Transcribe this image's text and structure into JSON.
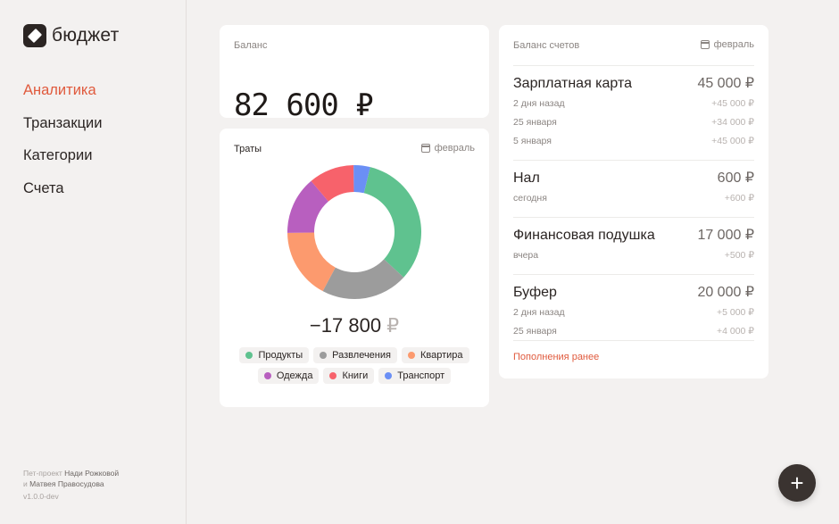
{
  "app": {
    "logo_text": "бюджет"
  },
  "nav": {
    "items": [
      {
        "label": "Аналитика",
        "active": true
      },
      {
        "label": "Транзакции",
        "active": false
      },
      {
        "label": "Категории",
        "active": false
      },
      {
        "label": "Счета",
        "active": false
      }
    ]
  },
  "credits": {
    "prefix": "Пет-проект ",
    "author1": "Нади Рожковой",
    "and": "и ",
    "author2": "Матвея Правосудова",
    "version": "v1.0.0-dev"
  },
  "balance": {
    "label": "Баланс",
    "value": "82 600 ₽"
  },
  "spending": {
    "title": "Траты",
    "month": "февраль",
    "total_value": "−17 800",
    "total_currency": "₽",
    "categories": [
      {
        "name": "Продукты",
        "color": "#5fc28f",
        "share": 33
      },
      {
        "name": "Развлечения",
        "color": "#9c9c9c",
        "share": 21
      },
      {
        "name": "Квартира",
        "color": "#fc9a6e",
        "share": 17
      },
      {
        "name": "Одежда",
        "color": "#b85fbf",
        "share": 14
      },
      {
        "name": "Книги",
        "color": "#f7626b",
        "share": 11
      },
      {
        "name": "Транспорт",
        "color": "#6b8ff5",
        "share": 4
      }
    ]
  },
  "accounts": {
    "title": "Баланс счетов",
    "month": "февраль",
    "items": [
      {
        "name": "Зарплатная карта",
        "amount": "45 000 ₽",
        "rows": [
          {
            "date": "2 дня назад",
            "value": "+45 000 ₽"
          },
          {
            "date": "25 января",
            "value": "+34 000 ₽"
          },
          {
            "date": "5 января",
            "value": "+45 000 ₽"
          }
        ]
      },
      {
        "name": "Нал",
        "amount": "600 ₽",
        "rows": [
          {
            "date": "сегодня",
            "value": "+600 ₽"
          }
        ]
      },
      {
        "name": "Финансовая подушка",
        "amount": "17 000 ₽",
        "rows": [
          {
            "date": "вчера",
            "value": "+500 ₽"
          }
        ]
      },
      {
        "name": "Буфер",
        "amount": "20 000 ₽",
        "rows": [
          {
            "date": "2 дня назад",
            "value": "+5 000 ₽"
          },
          {
            "date": "25 января",
            "value": "+4 000 ₽"
          }
        ]
      }
    ],
    "more_link": "Пополнения ранее"
  },
  "fab": {
    "label": "+"
  },
  "colors": {
    "accent": "#e05a3d",
    "dark": "#2b2523"
  }
}
